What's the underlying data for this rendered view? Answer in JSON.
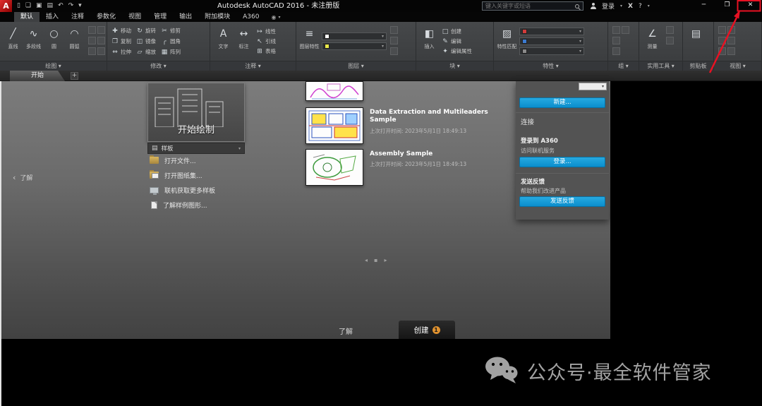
{
  "titlebar": {
    "logo": "A",
    "qat_icons": [
      {
        "name": "new-file-icon",
        "glyph": "▯"
      },
      {
        "name": "open-file-icon",
        "glyph": "❏"
      },
      {
        "name": "save-icon",
        "glyph": "▣"
      },
      {
        "name": "plot-icon",
        "glyph": "▤"
      },
      {
        "name": "undo-icon",
        "glyph": "↶"
      },
      {
        "name": "redo-icon",
        "glyph": "↷"
      },
      {
        "name": "qat-customize-icon",
        "glyph": "▾"
      }
    ],
    "title": "Autodesk AutoCAD 2016 - 未注册版",
    "search_placeholder": "键入关键字或短语",
    "signin": "登录",
    "exchange_icon": "X",
    "help_icon": "?",
    "window": {
      "minimize": "─",
      "maximize": "❐",
      "close": "✕"
    }
  },
  "ribbon": {
    "tabs": [
      {
        "label": "默认",
        "active": true
      },
      {
        "label": "插入"
      },
      {
        "label": "注释"
      },
      {
        "label": "参数化"
      },
      {
        "label": "视图"
      },
      {
        "label": "管理"
      },
      {
        "label": "输出"
      },
      {
        "label": "附加模块"
      },
      {
        "label": "A360"
      }
    ],
    "panels": [
      {
        "label": "绘图",
        "flyout": true,
        "big": [
          {
            "icon": "line",
            "label": "直线"
          },
          {
            "icon": "pline",
            "label": "多段线"
          },
          {
            "icon": "circle",
            "label": "圆"
          },
          {
            "icon": "arc",
            "label": "圆弧"
          }
        ],
        "mini": 6
      },
      {
        "label": "修改",
        "flyout": true,
        "grid": [
          {
            "icon": "move",
            "label": "移动"
          },
          {
            "icon": "copy",
            "label": "复制"
          },
          {
            "icon": "stretch",
            "label": "拉伸"
          },
          {
            "icon": "rotate",
            "label": "旋转"
          },
          {
            "icon": "mirror",
            "label": "镜像"
          },
          {
            "icon": "scale",
            "label": "缩放"
          },
          {
            "icon": "trim",
            "label": "修剪"
          },
          {
            "icon": "fillet",
            "label": "圆角"
          },
          {
            "icon": "array",
            "label": "阵列"
          }
        ]
      },
      {
        "label": "注释",
        "flyout": true,
        "big": [
          {
            "icon": "text",
            "label": "文字"
          },
          {
            "icon": "dim",
            "label": "标注"
          }
        ],
        "small": [
          {
            "icon": "linear",
            "label": "线性"
          },
          {
            "icon": "leader",
            "label": "引线"
          },
          {
            "icon": "table",
            "label": "表格"
          }
        ]
      },
      {
        "label": "图层",
        "flyout": true,
        "big": [
          {
            "icon": "layers",
            "label": "图层特性"
          }
        ],
        "drops": [
          {
            "swatch": "#ffffff"
          },
          {
            "swatch": "#e8e84a"
          }
        ],
        "mini": 3
      },
      {
        "label": "块",
        "flyout": true,
        "big": [
          {
            "icon": "insert",
            "label": "插入"
          }
        ],
        "small": [
          {
            "icon": "create",
            "label": "创建"
          },
          {
            "icon": "edit",
            "label": "编辑"
          },
          {
            "icon": "attr",
            "label": "编辑属性"
          }
        ]
      },
      {
        "label": "特性",
        "flyout": true,
        "big": [
          {
            "icon": "match",
            "label": "特性匹配"
          }
        ],
        "drops": [
          {
            "swatch": "#d23b3b"
          },
          {
            "swatch": "#3b7bd2"
          },
          {
            "swatch": "#8a8a8a"
          }
        ]
      },
      {
        "label": "组",
        "flyout": true,
        "mini": 4
      },
      {
        "label": "实用工具",
        "flyout": true,
        "big": [
          {
            "icon": "measure",
            "label": "测量"
          }
        ],
        "mini": 2
      },
      {
        "label": "剪贴板",
        "flyout": false,
        "big": [
          {
            "icon": "paste",
            "label": ""
          }
        ]
      },
      {
        "label": "视图",
        "flyout": true,
        "mini": 6
      }
    ]
  },
  "file_bar": {
    "start_tab": "开始",
    "new_tab": "+"
  },
  "start_page": {
    "learn_collapsed": "了解",
    "start_drawing": "开始绘制",
    "templates_label": "样板",
    "links": [
      {
        "icon": "folder",
        "label": "打开文件..."
      },
      {
        "icon": "folders",
        "label": "打开图纸集..."
      },
      {
        "icon": "monitor",
        "label": "联机获取更多样板"
      },
      {
        "icon": "page",
        "label": "了解样例图形..."
      }
    ],
    "recent_docs": [
      {
        "title": "Data Extraction and Multileaders Sample",
        "date": "上次打开时间: 2023年5月1日 18:49:13"
      },
      {
        "title": "Assembly Sample",
        "date": "上次打开时间: 2023年5月1日 18:49:13"
      }
    ],
    "right_panel": {
      "new_button": "新建...",
      "connect_header": "连接",
      "a360_title": "登录到 A360",
      "a360_sub": "访问联机服务",
      "signin_button": "登录...",
      "feedback_title": "发送反馈",
      "feedback_sub": "帮助我们改进产品",
      "feedback_button": "发送反馈"
    },
    "bottom_tabs": {
      "learn": "了解",
      "create": "创建",
      "create_badge": "1"
    }
  },
  "watermark": {
    "text": "公众号·最全软件管家"
  },
  "colors": {
    "accent_blue": "#0d9bdb",
    "annotation_red": "#e81123",
    "badge_orange": "#e0922f"
  }
}
